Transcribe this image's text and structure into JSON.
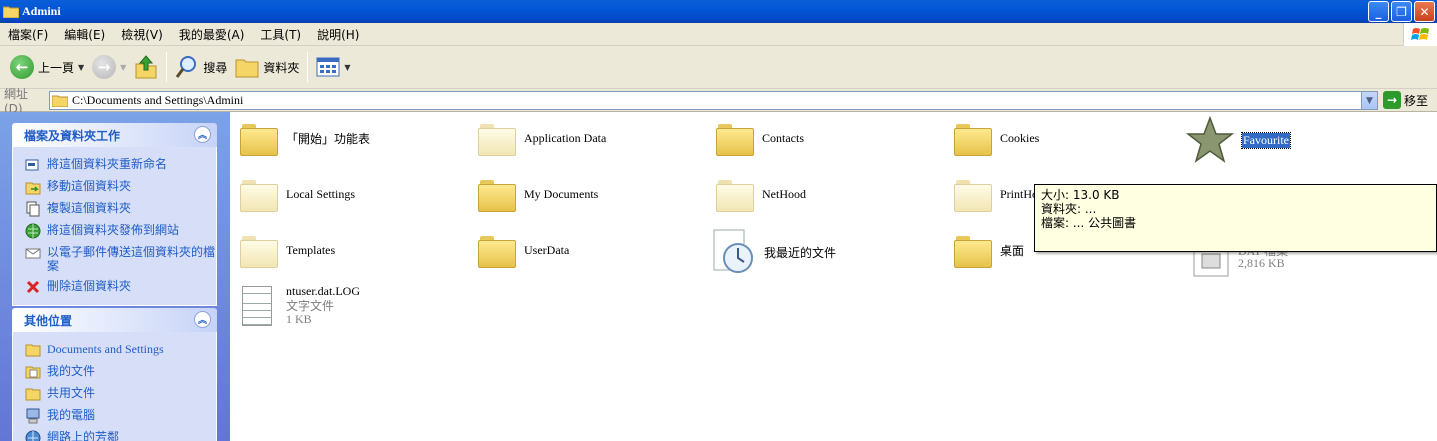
{
  "window": {
    "title": "Admini",
    "minimize_icon": "minimize-icon",
    "maximize_icon": "restore-icon",
    "close_icon": "close-icon"
  },
  "menu": [
    "檔案(F)",
    "編輯(E)",
    "檢視(V)",
    "我的最愛(A)",
    "工具(T)",
    "說明(H)"
  ],
  "toolbar": {
    "back_label": "上一頁",
    "search_label": "搜尋",
    "folders_label": "資料夾"
  },
  "address": {
    "label": "網址(D)",
    "path": "C:\\Documents and Settings\\Admini",
    "go_label": "移至"
  },
  "tasks_panel": {
    "title": "檔案及資料夾工作",
    "items": [
      {
        "label": "將這個資料夾重新命名",
        "icon": "rename-icon"
      },
      {
        "label": "移動這個資料夾",
        "icon": "move-icon"
      },
      {
        "label": "複製這個資料夾",
        "icon": "copy-icon"
      },
      {
        "label": "將這個資料夾發佈到網站",
        "icon": "publish-web-icon"
      },
      {
        "label": "以電子郵件傳送這個資料夾的檔案",
        "icon": "email-icon"
      },
      {
        "label": "刪除這個資料夾",
        "icon": "delete-icon"
      }
    ]
  },
  "places_panel": {
    "title": "其他位置",
    "items": [
      {
        "label": "Documents and Settings",
        "icon": "folder-icon"
      },
      {
        "label": "我的文件",
        "icon": "my-documents-icon"
      },
      {
        "label": "共用文件",
        "icon": "shared-documents-icon"
      },
      {
        "label": "我的電腦",
        "icon": "my-computer-icon"
      },
      {
        "label": "網路上的芳鄰",
        "icon": "network-icon"
      }
    ]
  },
  "files": [
    {
      "name": "「開始」功能表",
      "type": "folder"
    },
    {
      "name": "Application Data",
      "type": "folder-hidden"
    },
    {
      "name": "Contacts",
      "type": "folder"
    },
    {
      "name": "Cookies",
      "type": "folder"
    },
    {
      "name": "Favourite",
      "type": "favorites"
    },
    {
      "name": "Local Settings",
      "type": "folder-hidden"
    },
    {
      "name": "My Documents",
      "type": "folder"
    },
    {
      "name": "NetHood",
      "type": "folder-hidden"
    },
    {
      "name": "PrintHo",
      "type": "folder-hidden"
    },
    {
      "name": "Templates",
      "type": "folder-hidden"
    },
    {
      "name": "UserData",
      "type": "folder"
    },
    {
      "name": "我最近的文件",
      "type": "recent"
    },
    {
      "name": "桌面",
      "type": "folder"
    },
    {
      "name": "ntuser.dat.LOG",
      "type": "text",
      "kind": "文字文件",
      "size": "1 KB"
    }
  ],
  "partial_file": {
    "kind": "DAT 檔案",
    "size": "2,816 KB"
  },
  "tooltip": {
    "size_line": "大小: 13.0 KB",
    "folders_line": "資料夾: ...",
    "files_line": "檔案: ... 公共圖書"
  },
  "colors": {
    "titlebar": "#0356d6",
    "taskpane": "#6f8ddf",
    "link": "#215dc6",
    "selection": "#316ac5",
    "tooltip_bg": "#ffffe1"
  }
}
